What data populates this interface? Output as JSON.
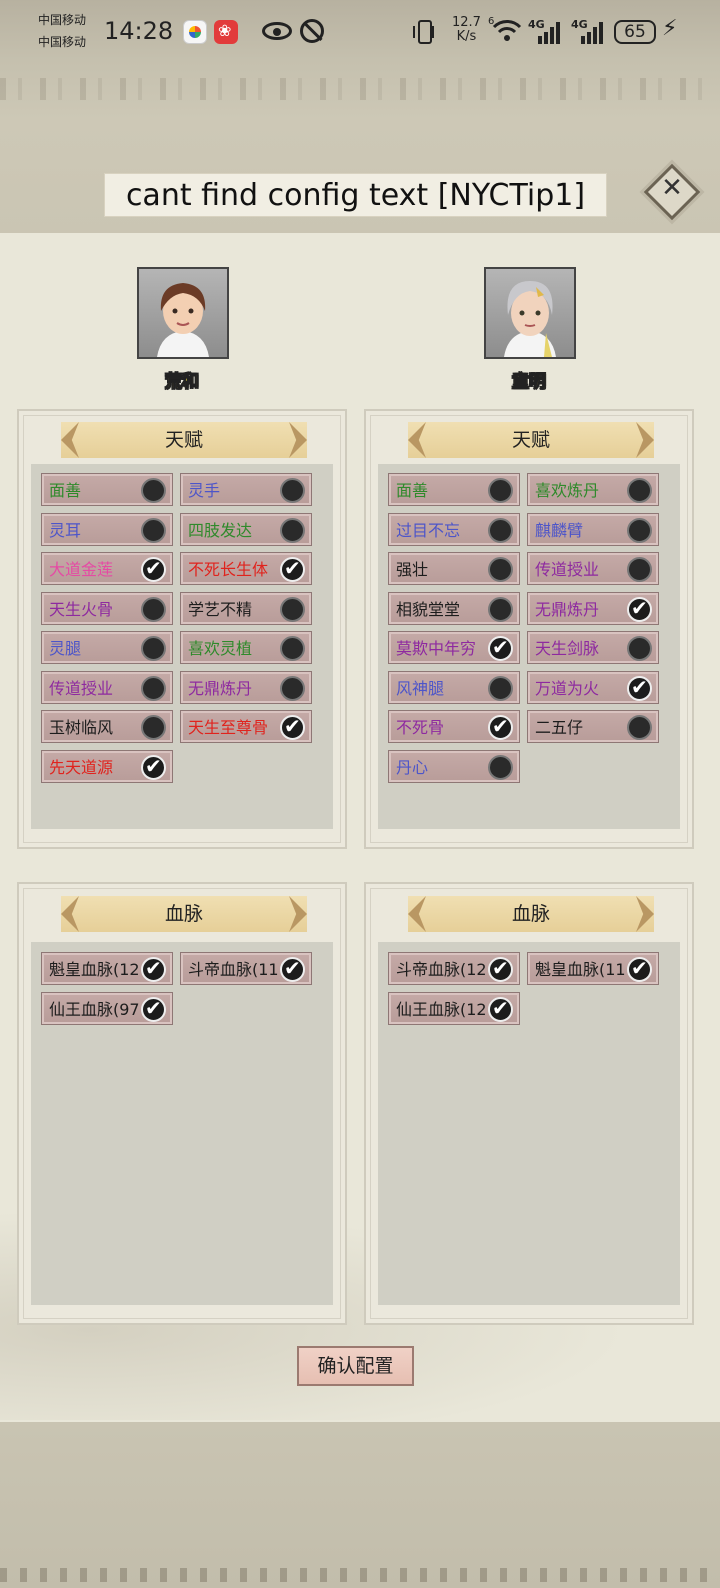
{
  "status_bar": {
    "carrier1": "中国移动",
    "carrier2": "中国移动",
    "time": "14:28",
    "net_speed": "12.7",
    "net_speed_unit": "K/s",
    "wifi_label": "6",
    "sig1_label": "4G",
    "sig2_label": "4G",
    "battery": "65",
    "icons": [
      "app-icon",
      "app-icon",
      "eye-icon",
      "alarm-icon",
      "vibrate-icon",
      "wifi-icon",
      "signal-icon",
      "signal-icon",
      "battery-icon",
      "charging-icon"
    ]
  },
  "title": "cant find config text [NYCTip1]",
  "close_icon": "close-icon",
  "characters": [
    {
      "name": "荒和",
      "talent_header": "天赋",
      "bloodline_header": "血脉",
      "talents": [
        {
          "label": "面善",
          "color": "green",
          "checked": false
        },
        {
          "label": "灵手",
          "color": "blue",
          "checked": false
        },
        {
          "label": "灵耳",
          "color": "blue",
          "checked": false
        },
        {
          "label": "四肢发达",
          "color": "green",
          "checked": false
        },
        {
          "label": "大道金莲",
          "color": "pink",
          "checked": true
        },
        {
          "label": "不死长生体",
          "color": "red",
          "checked": true
        },
        {
          "label": "天生火骨",
          "color": "purple",
          "checked": false
        },
        {
          "label": "学艺不精",
          "color": "black",
          "checked": false
        },
        {
          "label": "灵腿",
          "color": "blue",
          "checked": false
        },
        {
          "label": "喜欢灵植",
          "color": "green",
          "checked": false
        },
        {
          "label": "传道授业",
          "color": "purple",
          "checked": false
        },
        {
          "label": "无鼎炼丹",
          "color": "purple",
          "checked": false
        },
        {
          "label": "玉树临风",
          "color": "black",
          "checked": false
        },
        {
          "label": "天生至尊骨",
          "color": "red",
          "checked": true
        },
        {
          "label": "先天道源",
          "color": "red",
          "checked": true
        }
      ],
      "bloodlines": [
        {
          "label": "魁皇血脉(12",
          "color": "black",
          "checked": true
        },
        {
          "label": "斗帝血脉(11",
          "color": "black",
          "checked": true
        },
        {
          "label": "仙王血脉(97",
          "color": "black",
          "checked": true
        }
      ]
    },
    {
      "name": "童明",
      "talent_header": "天赋",
      "bloodline_header": "血脉",
      "talents": [
        {
          "label": "面善",
          "color": "green",
          "checked": false
        },
        {
          "label": "喜欢炼丹",
          "color": "green",
          "checked": false
        },
        {
          "label": "过目不忘",
          "color": "blue",
          "checked": false
        },
        {
          "label": "麒麟臂",
          "color": "blue",
          "checked": false
        },
        {
          "label": "强壮",
          "color": "black",
          "checked": false
        },
        {
          "label": "传道授业",
          "color": "purple",
          "checked": false
        },
        {
          "label": "相貌堂堂",
          "color": "black",
          "checked": false
        },
        {
          "label": "无鼎炼丹",
          "color": "purple",
          "checked": true
        },
        {
          "label": "莫欺中年穷",
          "color": "purple",
          "checked": true
        },
        {
          "label": "天生剑脉",
          "color": "purple",
          "checked": false
        },
        {
          "label": "风神腿",
          "color": "blue",
          "checked": false
        },
        {
          "label": "万道为火",
          "color": "purple",
          "checked": true
        },
        {
          "label": "不死骨",
          "color": "purple",
          "checked": true
        },
        {
          "label": "二五仔",
          "color": "black",
          "checked": false
        },
        {
          "label": "丹心",
          "color": "blue",
          "checked": false
        }
      ],
      "bloodlines": [
        {
          "label": "斗帝血脉(12",
          "color": "black",
          "checked": true
        },
        {
          "label": "魁皇血脉(11",
          "color": "black",
          "checked": true
        },
        {
          "label": "仙王血脉(12",
          "color": "black",
          "checked": true
        }
      ]
    }
  ],
  "confirm_label": "确认配置"
}
